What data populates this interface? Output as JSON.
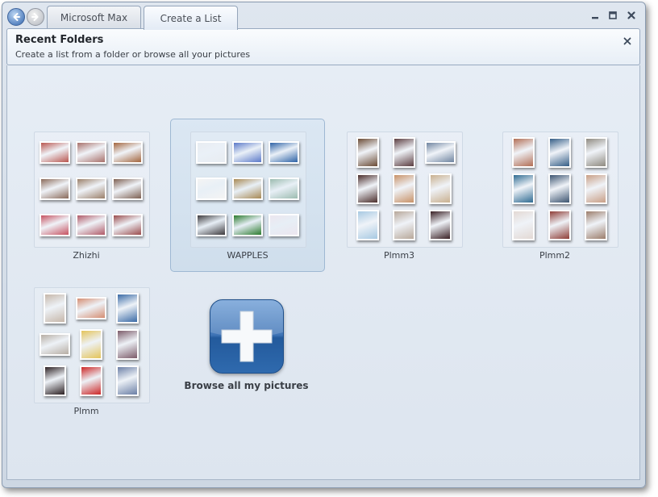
{
  "tabs": [
    {
      "label": "Microsoft Max"
    },
    {
      "label": "Create a List"
    }
  ],
  "header": {
    "title": "Recent Folders",
    "subtitle": "Create a list from a folder or browse all your pictures"
  },
  "folders": [
    {
      "name": "Zhizhi",
      "thumb_colors": [
        "#b9564f",
        "#a8706a",
        "#a3653d",
        "#8a6a59",
        "#9a7f69",
        "#7d6052",
        "#c65160",
        "#b05967",
        "#9a4b4c"
      ]
    },
    {
      "name": "WAPPLES",
      "thumb_colors": [
        "#e8ecf1",
        "#5b79c9",
        "#2d62a6",
        "#f4f4f4",
        "#a88954",
        "#9cbcb0",
        "#3d3a3d",
        "#2c7b2e",
        "#ece6ef"
      ]
    },
    {
      "name": "Plmm3",
      "thumb_colors": [
        "#6a4b35",
        "#5b3d40",
        "#6f84a0",
        "#4b2e2c",
        "#c89268",
        "#c9b08f",
        "#a7c9e2",
        "#b8a89a",
        "#3a2024"
      ]
    },
    {
      "name": "Plmm2",
      "thumb_colors": [
        "#b26e55",
        "#345d86",
        "#8f8a80",
        "#2f6b92",
        "#3c5470",
        "#c99f86",
        "#e3d9d4",
        "#8f3d36",
        "#9c7d6b"
      ]
    },
    {
      "name": "Plmm",
      "thumb_colors": [
        "#c6b7aa",
        "#d58d72",
        "#3a6aa6",
        "#b7aea4",
        "#e4c45a",
        "#7c5b69",
        "#2b2022",
        "#cc2727",
        "#6b7fa6"
      ]
    }
  ],
  "browse": {
    "label": "Browse all my pictures"
  },
  "icons": {
    "back": "back-arrow-icon",
    "forward": "forward-arrow-icon",
    "minimize": "minimize-icon",
    "maximize": "maximize-icon",
    "close": "close-icon",
    "browse": "plus-icon"
  },
  "colors": {
    "accent": "#3f74b6",
    "selected_folder": "#cfdeec"
  }
}
